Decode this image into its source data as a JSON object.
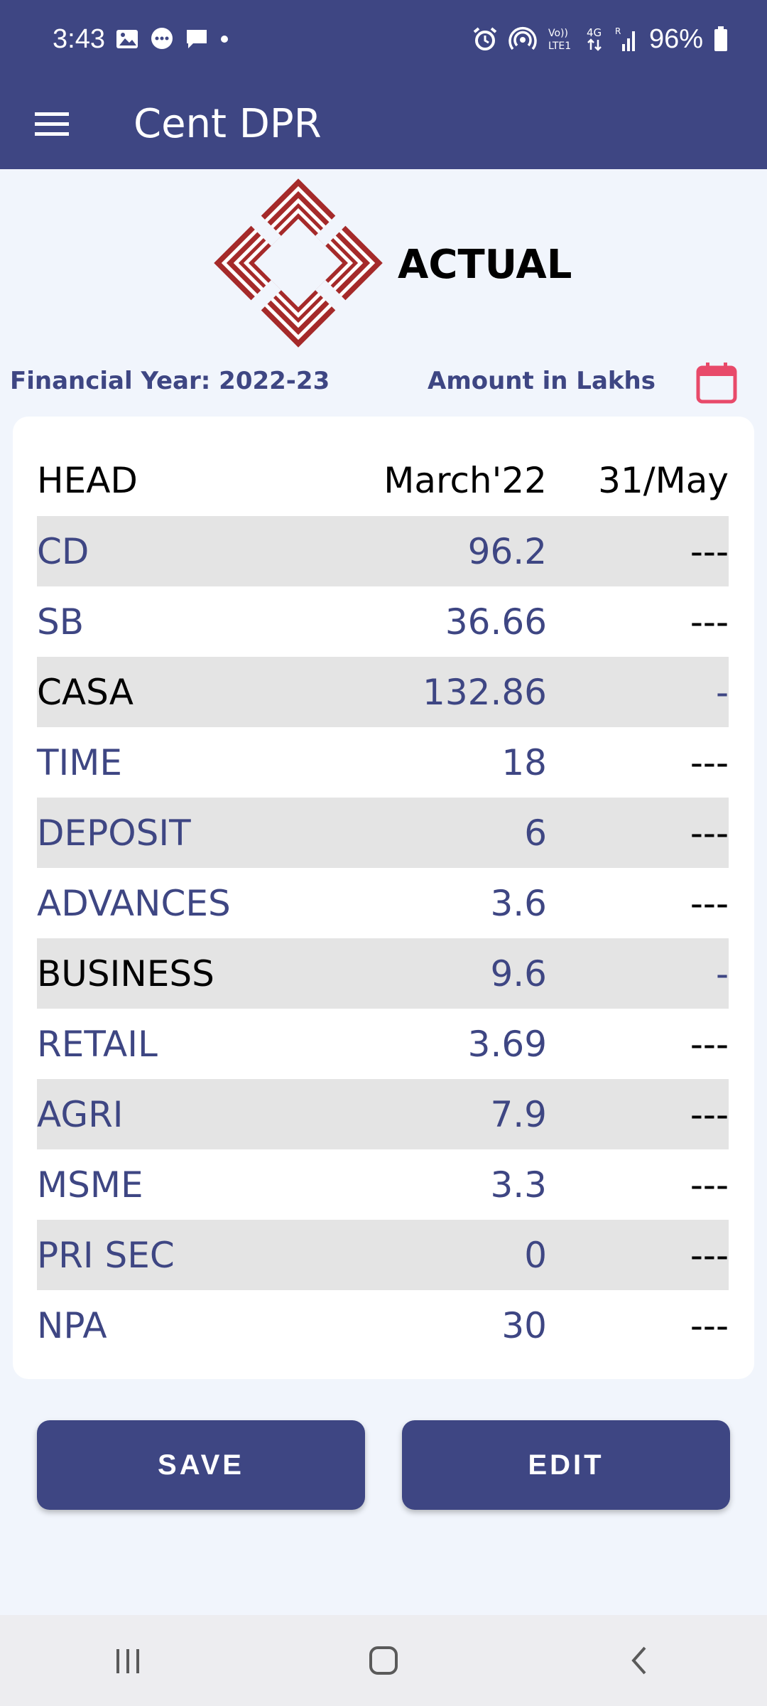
{
  "status_bar": {
    "time": "3:43",
    "battery": "96%",
    "network": "4G"
  },
  "app_bar": {
    "title": "Cent DPR"
  },
  "hero": {
    "title": "ACTUAL"
  },
  "info": {
    "financial_year": "Financial Year: 2022-23",
    "amount_unit": "Amount in Lakhs"
  },
  "table": {
    "headers": [
      "HEAD",
      "March'22",
      "31/May"
    ],
    "rows": [
      {
        "head": "CD",
        "march": "96.2",
        "may": "---"
      },
      {
        "head": "SB",
        "march": "36.66",
        "may": "---"
      },
      {
        "head": "CASA",
        "march": "132.86",
        "may": "-"
      },
      {
        "head": "TIME",
        "march": "18",
        "may": "---"
      },
      {
        "head": "DEPOSIT",
        "march": "6",
        "may": "---"
      },
      {
        "head": "ADVANCES",
        "march": "3.6",
        "may": "---"
      },
      {
        "head": "BUSINESS",
        "march": "9.6",
        "may": "-"
      },
      {
        "head": "RETAIL",
        "march": "3.69",
        "may": "---"
      },
      {
        "head": "AGRI",
        "march": "7.9",
        "may": "---"
      },
      {
        "head": "MSME",
        "march": "3.3",
        "may": "---"
      },
      {
        "head": "PRI SEC",
        "march": "0",
        "may": "---"
      },
      {
        "head": "NPA",
        "march": "30",
        "may": "---"
      }
    ]
  },
  "buttons": {
    "save_label": "SAVE",
    "edit_label": "EDIT"
  },
  "colors": {
    "primary": "#3e4683",
    "accent": "#e84a6a",
    "logo_red": "#a52a2a",
    "row_shade": "#e4e4e4",
    "background": "#f1f5fc"
  }
}
